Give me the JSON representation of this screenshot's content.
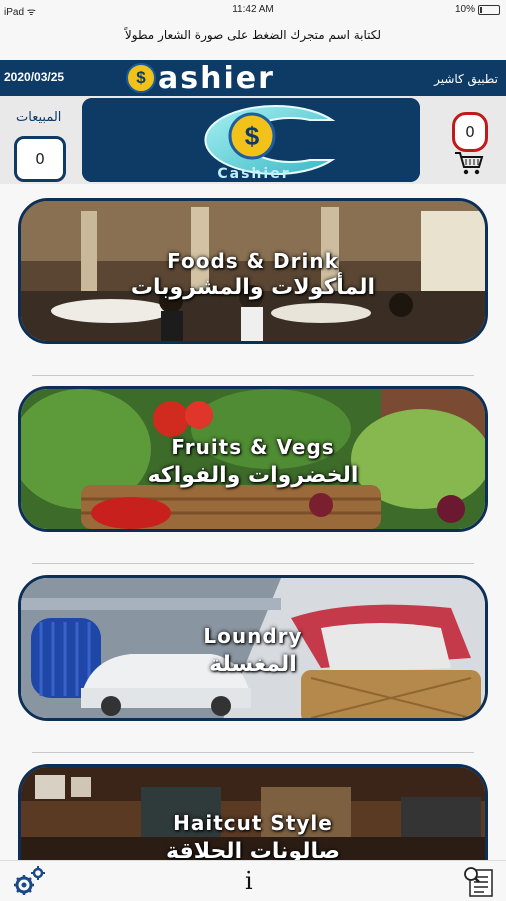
{
  "status_bar": {
    "device": "iPad",
    "time": "11:42 AM",
    "battery": "10%"
  },
  "hint": "لكتابة اسم متجرك الضغط على صورة الشعار مطولاً",
  "header": {
    "date": "2020/03/25",
    "brand": "ashier",
    "brand_coin": "$",
    "app_title": "تطبيق كاشير",
    "logo_sub": "Cashier"
  },
  "sales": {
    "label": "المبيعات",
    "count": "0"
  },
  "cart": {
    "count": "0"
  },
  "categories": [
    {
      "en": "Foods & Drink",
      "ar": "المأكولات والمشروبات"
    },
    {
      "en": "Fruits & Vegs",
      "ar": "الخضروات والفواكه"
    },
    {
      "en": "Loundry",
      "ar": "المغسلة"
    },
    {
      "en": "Haitcut Style",
      "ar": "صالونات الحلاقة"
    }
  ],
  "bottom_bar": {
    "info": "i"
  },
  "icons": {
    "settings": "gears-icon",
    "info": "info-icon",
    "report": "report-icon",
    "cart": "cart-icon"
  }
}
